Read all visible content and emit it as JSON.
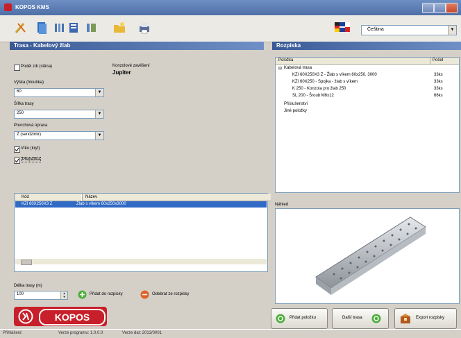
{
  "window": {
    "title": "KOPOS KMS"
  },
  "toolbar": {
    "language": "Čeština"
  },
  "left": {
    "header": "Trasa - Kabelový žlab",
    "option_label": "Podél zdi (stěna)",
    "support_label": "Konzolové zavěšení",
    "support_value": "Jupiter",
    "field1": {
      "label": "Výška (hloubka)",
      "value": "60"
    },
    "field2": {
      "label": "Šířka trasy",
      "value": "250"
    },
    "field3": {
      "label": "Povrchová úprava",
      "value": "Z (sendzimir)"
    },
    "check1": "Víko (kryt)",
    "check2": "Přepážka",
    "list": {
      "col1": "Kód",
      "col2": "Název",
      "row_code": "KZI 60X250X3 Z",
      "row_name": "Žlab s víkem 60x250x3000"
    },
    "length_label": "Délka trasy (m)",
    "length_value": "100",
    "add_button": "Přidat do rozpisky",
    "remove_button": "Odebrat ze rozpisky"
  },
  "right": {
    "header": "Rozpiska",
    "col1": "Položka",
    "col2": "Počet",
    "tree": [
      {
        "text": "Kabelová trasa",
        "count": ""
      },
      {
        "text": "KZI 60X250X3 Z - Žlab s víkem 60x250, 3000",
        "count": "33ks"
      },
      {
        "text": "KZI 60X250 - Spojka - žlab s víkem",
        "count": "33ks"
      },
      {
        "text": "K 250 - Konzola pro žlab 250",
        "count": "33ks"
      },
      {
        "text": "SL 200 - Šroub M6x12",
        "count": "66ks"
      },
      {
        "text": "Příslušenství",
        "count": ""
      },
      {
        "text": "Jiné položky",
        "count": ""
      }
    ],
    "preview_label": "Náhled"
  },
  "bottom": {
    "logo": "KOPOS",
    "btn1": "Přidat položku",
    "btn2": "Další trasa",
    "btn3": "Export rozpisky"
  },
  "status": {
    "s1": "Přihlášení:",
    "s2": "Verze programu: 1.0.0.0",
    "s3": "Verze dat: 2013/0001"
  }
}
